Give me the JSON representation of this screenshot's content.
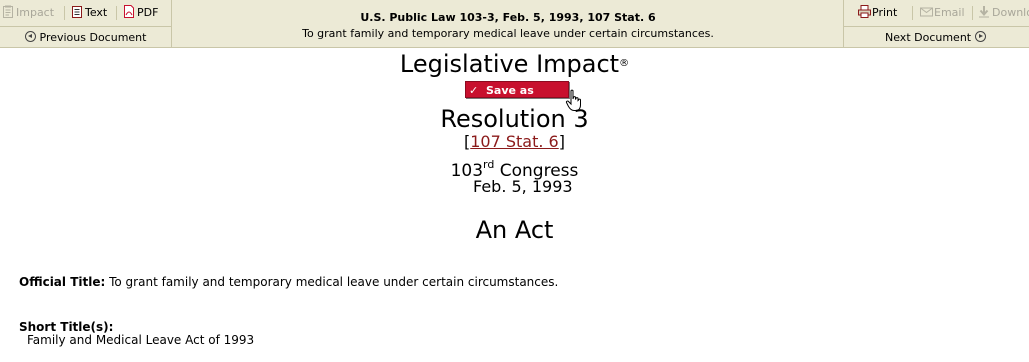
{
  "toolbar": {
    "impact_label": "Impact",
    "text_label": "Text",
    "pdf_label": "PDF",
    "previous_label": "Previous Document",
    "doc_title": "U.S. Public Law 103-3, Feb. 5, 1993, 107 Stat. 6",
    "doc_subtitle": "To grant family and temporary medical leave under certain circumstances.",
    "print_label": "Print",
    "email_label": "Email",
    "download_label": "Downlo",
    "next_label": "Next Document"
  },
  "main": {
    "app_title": "Legislative Impact",
    "registered_mark": "®",
    "save_alert_label": "Save as Alert",
    "resolution_title": "Resolution 3",
    "stat_open": "[",
    "stat_link": "107 Stat. 6",
    "stat_close": "]",
    "congress_number": "103",
    "congress_suffix": "rd",
    "congress_word": " Congress",
    "date": "Feb. 5, 1993",
    "act_heading": "An Act",
    "official_title_label": "Official Title:",
    "official_title_value": " To grant family and temporary medical leave under certain circumstances.",
    "short_titles_label": "Short Title(s):",
    "short_title_value": "Family and Medical Leave Act of 1993"
  },
  "colors": {
    "toolbar_bg": "#ecead6",
    "alert_button": "#c8102e",
    "link": "#8b1a1a"
  }
}
